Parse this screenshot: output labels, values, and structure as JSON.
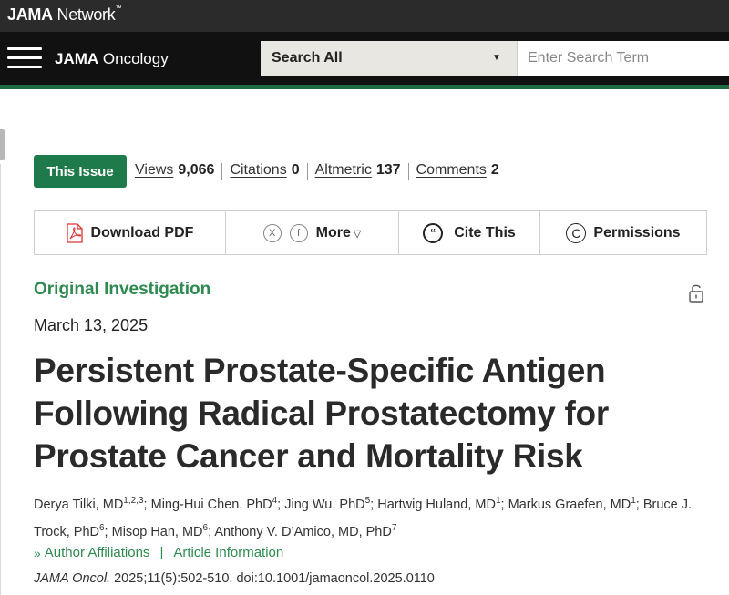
{
  "network": {
    "logo_bold": "JAMA",
    "logo_rest": " Network",
    "trademark": "™"
  },
  "journal": {
    "name_bold": "JAMA",
    "name_rest": " Oncology"
  },
  "search": {
    "scope": "Search All",
    "placeholder": "Enter Search Term"
  },
  "issue_button": "This Issue",
  "metrics": [
    {
      "label": "Views",
      "value": "9,066"
    },
    {
      "label": "Citations",
      "value": "0"
    },
    {
      "label": "Altmetric",
      "value": "137"
    },
    {
      "label": "Comments",
      "value": "2"
    }
  ],
  "actions": {
    "download_pdf": "Download PDF",
    "share_x": "X",
    "share_facebook": "f",
    "more": "More",
    "cite": "Cite This",
    "permissions": "Permissions"
  },
  "article": {
    "type": "Original Investigation",
    "date": "March 13, 2025",
    "title": "Persistent Prostate-Specific Antigen Following Radical Prostatectomy for Prostate Cancer and Mortality Risk",
    "authors": [
      {
        "name": "Derya Tilki, MD",
        "aff": "1,2,3"
      },
      {
        "name": "Ming-Hui Chen, PhD",
        "aff": "4"
      },
      {
        "name": "Jing Wu, PhD",
        "aff": "5"
      },
      {
        "name": "Hartwig Huland, MD",
        "aff": "1"
      },
      {
        "name": "Markus Graefen, MD",
        "aff": "1"
      },
      {
        "name": "Bruce J. Trock, PhD",
        "aff": "6"
      },
      {
        "name": "Misop Han, MD",
        "aff": "6"
      },
      {
        "name": "Anthony V. D’Amico, MD, PhD",
        "aff": "7"
      }
    ],
    "affiliations_link": "Author Affiliations",
    "info_link": "Article Information",
    "citation_journal": "JAMA Oncol.",
    "citation_rest": " 2025;11(5):502-510. doi:10.1001/jamaoncol.2025.0110"
  }
}
